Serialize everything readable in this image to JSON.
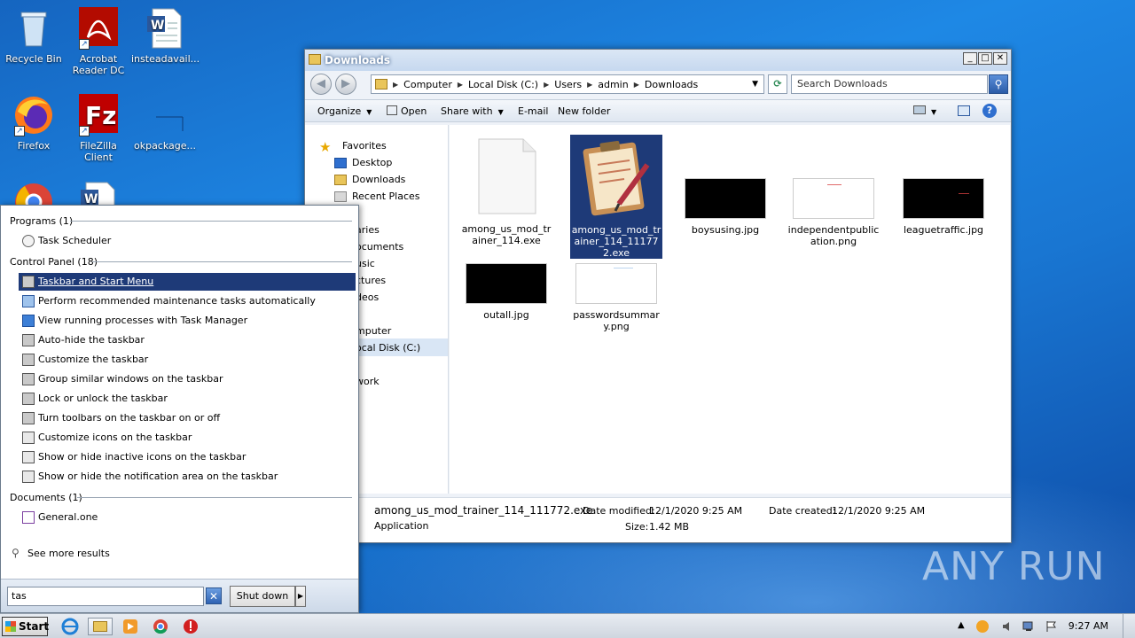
{
  "desktop": {
    "icons": [
      {
        "label": "Recycle Bin"
      },
      {
        "label": "Acrobat Reader DC"
      },
      {
        "label": "insteadavail..."
      },
      {
        "label": "Firefox"
      },
      {
        "label": "FileZilla Client"
      },
      {
        "label": "okpackage..."
      }
    ]
  },
  "explorer": {
    "title": "Downloads",
    "address": [
      "Computer",
      "Local Disk (C:)",
      "Users",
      "admin",
      "Downloads"
    ],
    "search_placeholder": "Search Downloads",
    "commands": {
      "organize": "Organize",
      "open": "Open",
      "share_with": "Share with",
      "email": "E-mail",
      "new_folder": "New folder"
    },
    "nav": {
      "favorites": "Favorites",
      "desktop": "Desktop",
      "downloads": "Downloads",
      "recent": "Recent Places",
      "libraries_partial": "aries",
      "documents_partial": "ocuments",
      "music_partial": "usic",
      "pictures_partial": "ctures",
      "videos_partial": "deos",
      "computer_partial": "mputer",
      "localdisk_partial": "ocal Disk (C:)",
      "network_partial": "work"
    },
    "files": [
      {
        "name": "among_us_mod_trainer_114.exe"
      },
      {
        "name": "among_us_mod_trainer_114_111772.exe"
      },
      {
        "name": "boysusing.jpg"
      },
      {
        "name": "independentpublication.png"
      },
      {
        "name": "leaguetraffic.jpg"
      },
      {
        "name": "outall.jpg"
      },
      {
        "name": "passwordsummary.png"
      }
    ],
    "details": {
      "filename": "among_us_mod_trainer_114_111772.exe",
      "type": "Application",
      "modified_label": "Date modified:",
      "modified": "12/1/2020 9:25 AM",
      "created_label": "Date created:",
      "created": "12/1/2020 9:25 AM",
      "size_label": "Size:",
      "size": "1.42 MB"
    }
  },
  "startmenu": {
    "programs_header": "Programs (1)",
    "programs": [
      "Task Scheduler"
    ],
    "control_header": "Control Panel (18)",
    "control_items": [
      "Taskbar and Start Menu",
      "Perform recommended maintenance tasks automatically",
      "View running processes with Task Manager",
      "Auto-hide the taskbar",
      "Customize the taskbar",
      "Group similar windows on the taskbar",
      "Lock or unlock the taskbar",
      "Turn toolbars on the taskbar on or off",
      "Customize icons on the taskbar",
      "Show or hide inactive icons on the taskbar",
      "Show or hide the notification area on the taskbar"
    ],
    "documents_header": "Documents (1)",
    "documents": [
      "General.one"
    ],
    "see_more": "See more results",
    "search_value": "tas",
    "shutdown": "Shut down"
  },
  "taskbar": {
    "start_label": "Start",
    "clock": "9:27 AM"
  },
  "watermark": "ANY RUN",
  "colors": {
    "selection": "#1e3a78",
    "desktop": "#1976d2"
  }
}
